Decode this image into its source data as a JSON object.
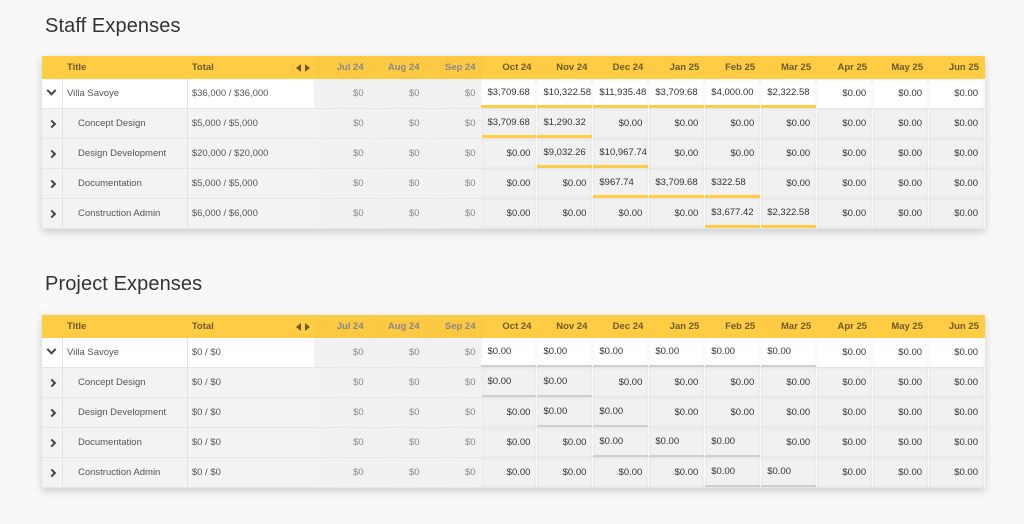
{
  "months": [
    "Jul 24",
    "Aug 24",
    "Sep 24",
    "Oct 24",
    "Nov 24",
    "Dec 24",
    "Jan 25",
    "Feb 25",
    "Mar 25",
    "Apr 25",
    "May 25",
    "Jun 25"
  ],
  "past_month_count": 3,
  "header": {
    "title": "Title",
    "total": "Total"
  },
  "tables": [
    {
      "title": "Staff Expenses",
      "rows": [
        {
          "title": "Villa Savoye",
          "type": "parent",
          "total": "$36,000 / $36,000",
          "values": [
            "$0",
            "$0",
            "$0",
            "$3,709.68",
            "$10,322.58",
            "$11,935.48",
            "$3,709.68",
            "$4,000.00",
            "$2,322.58",
            "$0.00",
            "$0.00",
            "$0.00"
          ],
          "active": [
            false,
            false,
            false,
            true,
            true,
            true,
            true,
            true,
            true,
            false,
            false,
            false
          ]
        },
        {
          "title": "Concept Design",
          "type": "child",
          "total": "$5,000 / $5,000",
          "values": [
            "$0",
            "$0",
            "$0",
            "$3,709.68",
            "$1,290.32",
            "$0.00",
            "$0.00",
            "$0.00",
            "$0.00",
            "$0.00",
            "$0.00",
            "$0.00"
          ],
          "active": [
            false,
            false,
            false,
            true,
            true,
            false,
            false,
            false,
            false,
            false,
            false,
            false
          ]
        },
        {
          "title": "Design Development",
          "type": "child",
          "total": "$20,000 / $20,000",
          "values": [
            "$0",
            "$0",
            "$0",
            "$0.00",
            "$9,032.26",
            "$10,967.74",
            "$0.00",
            "$0.00",
            "$0.00",
            "$0.00",
            "$0.00",
            "$0.00"
          ],
          "active": [
            false,
            false,
            false,
            false,
            true,
            true,
            false,
            false,
            false,
            false,
            false,
            false
          ]
        },
        {
          "title": "Documentation",
          "type": "child",
          "total": "$5,000 / $5,000",
          "values": [
            "$0",
            "$0",
            "$0",
            "$0.00",
            "$0.00",
            "$967.74",
            "$3,709.68",
            "$322.58",
            "$0.00",
            "$0.00",
            "$0.00",
            "$0.00"
          ],
          "active": [
            false,
            false,
            false,
            false,
            false,
            true,
            true,
            true,
            false,
            false,
            false,
            false
          ]
        },
        {
          "title": "Construction Admin",
          "type": "child",
          "total": "$6,000 / $6,000",
          "values": [
            "$0",
            "$0",
            "$0",
            "$0.00",
            "$0.00",
            "$0.00",
            "$0.00",
            "$3,677.42",
            "$2,322.58",
            "$0.00",
            "$0.00",
            "$0.00"
          ],
          "active": [
            false,
            false,
            false,
            false,
            false,
            false,
            false,
            true,
            true,
            false,
            false,
            false
          ]
        }
      ],
      "bar_color": "#ffcc44"
    },
    {
      "title": "Project Expenses",
      "rows": [
        {
          "title": "Villa Savoye",
          "type": "parent",
          "total": "$0 / $0",
          "values": [
            "$0",
            "$0",
            "$0",
            "$0.00",
            "$0.00",
            "$0.00",
            "$0.00",
            "$0.00",
            "$0.00",
            "$0.00",
            "$0.00",
            "$0.00"
          ],
          "active": [
            false,
            false,
            false,
            true,
            true,
            true,
            true,
            true,
            true,
            false,
            false,
            false
          ]
        },
        {
          "title": "Concept Design",
          "type": "child",
          "total": "$0 / $0",
          "values": [
            "$0",
            "$0",
            "$0",
            "$0.00",
            "$0.00",
            "$0.00",
            "$0.00",
            "$0.00",
            "$0.00",
            "$0.00",
            "$0.00",
            "$0.00"
          ],
          "active": [
            false,
            false,
            false,
            true,
            true,
            false,
            false,
            false,
            false,
            false,
            false,
            false
          ]
        },
        {
          "title": "Design Development",
          "type": "child",
          "total": "$0 / $0",
          "values": [
            "$0",
            "$0",
            "$0",
            "$0.00",
            "$0.00",
            "$0.00",
            "$0.00",
            "$0.00",
            "$0.00",
            "$0.00",
            "$0.00",
            "$0.00"
          ],
          "active": [
            false,
            false,
            false,
            false,
            true,
            true,
            false,
            false,
            false,
            false,
            false,
            false
          ]
        },
        {
          "title": "Documentation",
          "type": "child",
          "total": "$0 / $0",
          "values": [
            "$0",
            "$0",
            "$0",
            "$0.00",
            "$0.00",
            "$0.00",
            "$0.00",
            "$0.00",
            "$0.00",
            "$0.00",
            "$0.00",
            "$0.00"
          ],
          "active": [
            false,
            false,
            false,
            false,
            false,
            true,
            true,
            true,
            false,
            false,
            false,
            false
          ]
        },
        {
          "title": "Construction Admin",
          "type": "child",
          "total": "$0 / $0",
          "values": [
            "$0",
            "$0",
            "$0",
            "$0.00",
            "$0.00",
            "$0.00",
            "$0.00",
            "$0.00",
            "$0.00",
            "$0.00",
            "$0.00",
            "$0.00"
          ],
          "active": [
            false,
            false,
            false,
            false,
            false,
            false,
            false,
            true,
            true,
            false,
            false,
            false
          ]
        }
      ],
      "bar_color": "#cfcfcf"
    }
  ],
  "icons": {
    "expanded": "chevron-down-icon",
    "collapsed": "chevron-right-icon",
    "prev": "caret-left-icon",
    "next": "caret-right-icon"
  },
  "colors": {
    "header": "#ffcc44",
    "accent_bar": "#ffcc44"
  }
}
